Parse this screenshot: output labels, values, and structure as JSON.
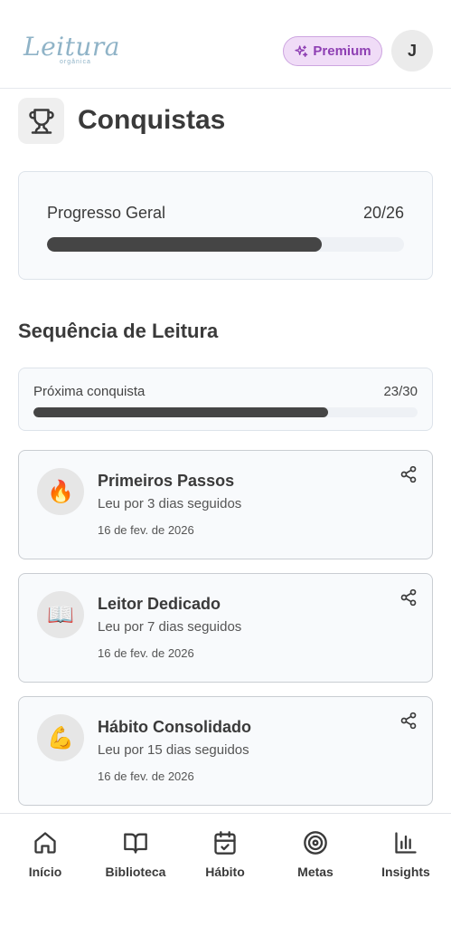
{
  "header": {
    "logo_text": "Leitura",
    "logo_sub": "orgânica",
    "premium_label": "Premium",
    "avatar_initial": "J"
  },
  "page": {
    "title": "Conquistas",
    "title_icon": "trophy-icon"
  },
  "overall": {
    "label": "Progresso Geral",
    "count": "20/26",
    "progress": 0.769
  },
  "section": {
    "title": "Sequência de Leitura"
  },
  "next": {
    "label": "Próxima conquista",
    "count": "23/30",
    "progress": 0.767
  },
  "achievements": [
    {
      "icon": "🔥",
      "icon_name": "fire-icon",
      "title": "Primeiros Passos",
      "desc": "Leu por 3 dias seguidos",
      "date": "16 de fev. de 2026"
    },
    {
      "icon": "📖",
      "icon_name": "book-icon",
      "title": "Leitor Dedicado",
      "desc": "Leu por 7 dias seguidos",
      "date": "16 de fev. de 2026"
    },
    {
      "icon": "💪",
      "icon_name": "muscle-icon",
      "title": "Hábito Consolidado",
      "desc": "Leu por 15 dias seguidos",
      "date": "16 de fev. de 2026"
    }
  ],
  "nav": {
    "items": [
      {
        "label": "Início",
        "icon": "home-icon"
      },
      {
        "label": "Biblioteca",
        "icon": "book-open-icon"
      },
      {
        "label": "Hábito",
        "icon": "calendar-check-icon"
      },
      {
        "label": "Metas",
        "icon": "target-icon"
      },
      {
        "label": "Insights",
        "icon": "bar-chart-icon"
      }
    ]
  },
  "colors": {
    "premium_bg": "#f0dcf7",
    "premium_text": "#8e3fb3",
    "progress_fill": "#454545",
    "progress_track": "#eef1f5",
    "logo": "#8fb3c7"
  }
}
